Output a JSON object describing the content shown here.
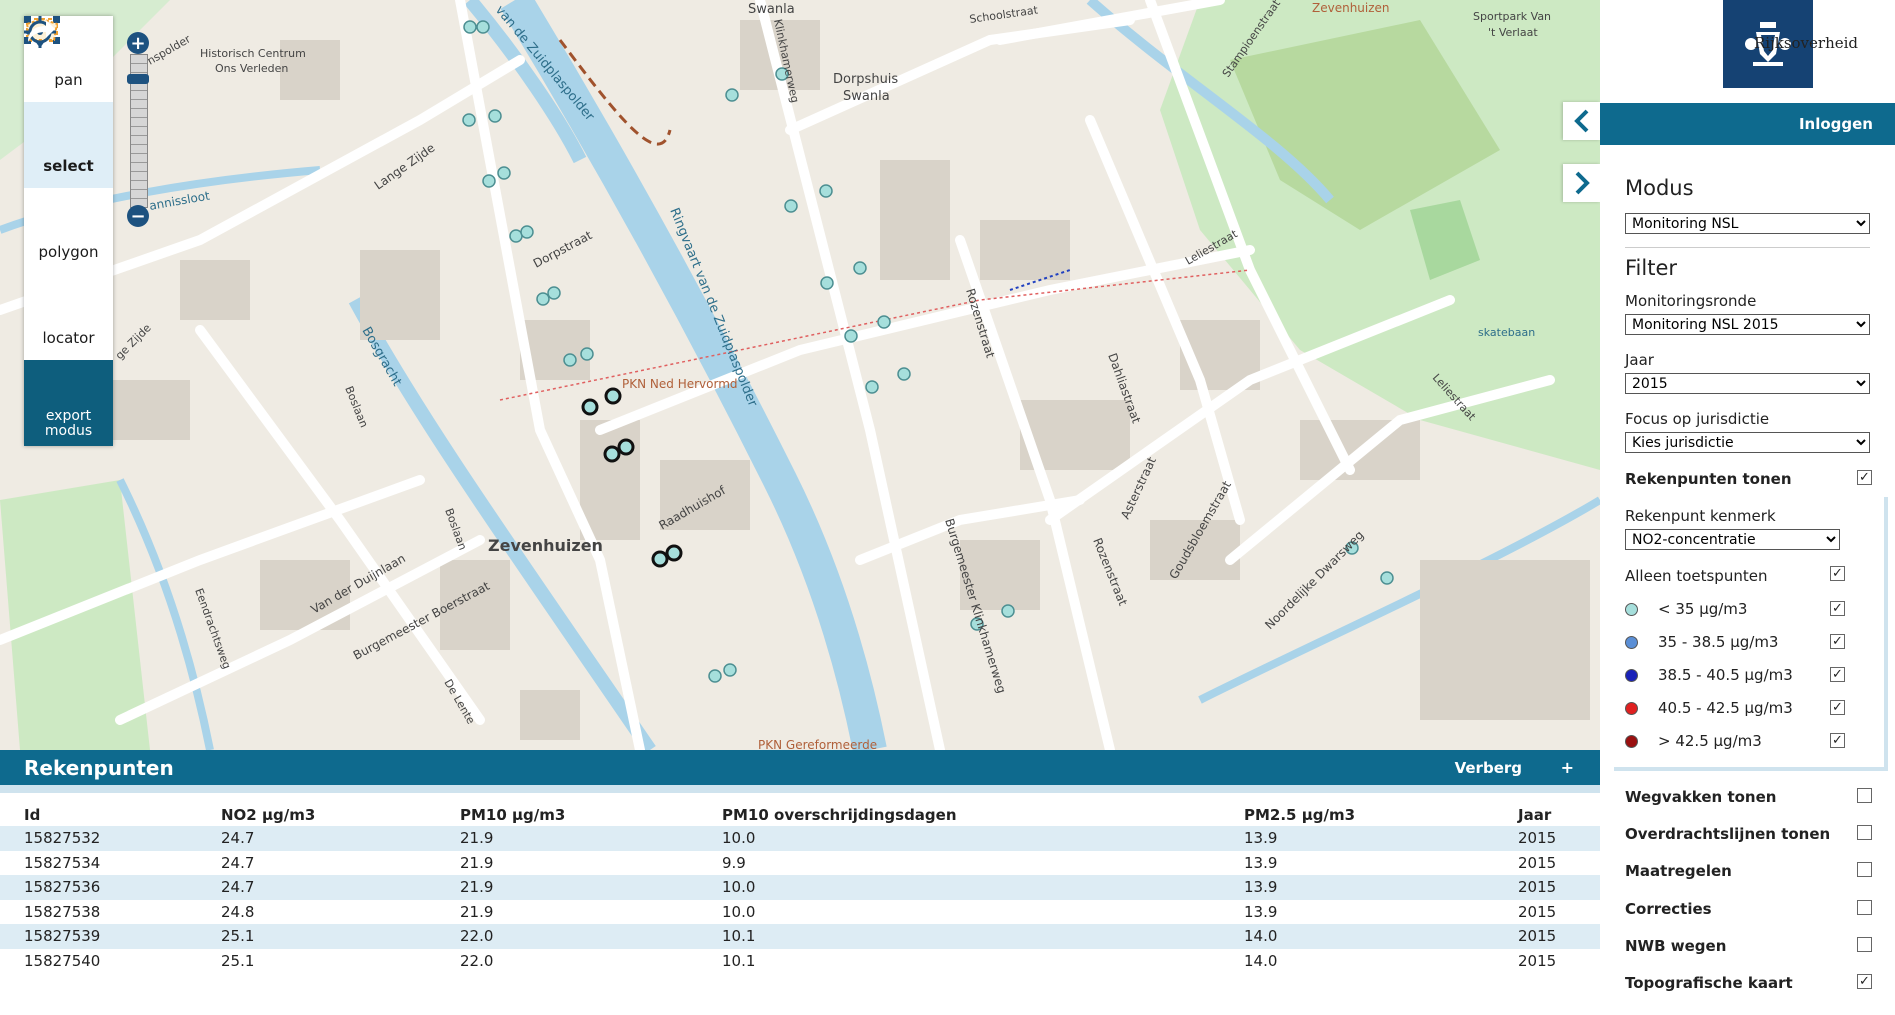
{
  "toolbar": {
    "pan": "pan",
    "select": "select",
    "polygon": "polygon",
    "locator": "locator",
    "export": "export modus"
  },
  "map": {
    "labels": {
      "town": "Zevenhuizen",
      "zevenhuizen_ne": "Zevenhuizen",
      "swanla": "Swanla",
      "dorpshuis": "Dorpshuis",
      "swanla2": "Swanla",
      "pkn_herv": "PKN Ned Hervormd",
      "pkn_geref": "PKN Gereformeerde",
      "historisch": "Historisch Centrum",
      "ons_verleden": "Ons Verleden",
      "sportpark": "Sportpark Van",
      "sportpark2": "'t Verlaat",
      "skatebaan": "skatebaan",
      "ringvaart": "Ringvaart van de Zuidplaspolder",
      "ringvaart2": "van de Zuidplaspolder",
      "bosgracht": "Bosgracht",
      "dorpstraat": "Dorpstraat",
      "lange_zijde": "Lange Zijde",
      "burgemeester_boerstraat": "Burgemeester Boerstraat",
      "van_der_duijnlaan": "Van der Duijnlaan",
      "kerkstraat": "Burgemeester Klinkhamerweg",
      "rozenstraat": "Rozenstraat",
      "rozenstraat2": "Rozenstraat",
      "dahliastraat": "Dahliastraat",
      "asterstraat": "Asterstraat",
      "goudsbloemstraat": "Goudsbloemstraat",
      "noordelijke_dwarsweg": "Noordelijke Dwarsweg",
      "schoolstraat": "Schoolstraat",
      "stampioenstraat": "Stampioenstraat",
      "leliestraat": "Leliestraat",
      "leliestraat2": "Leliestraat",
      "raadhuishof": "Raadhuishof",
      "klinkhamerweg": "Klinkhamerweg",
      "bosiaan": "Boslaan",
      "boslaan2": "Boslaan",
      "de_lente": "De Lente",
      "eendrachtsweg": "Eendrachtsweg",
      "annissloot": "annissloot",
      "nuge_zijde": "ge Zijde",
      "hansploder": "nspolder"
    }
  },
  "results": {
    "title": "Rekenpunten",
    "hide_label": "Verberg",
    "plus_label": "+",
    "columns": [
      "Id",
      "NO2 µg/m3",
      "PM10 µg/m3",
      "PM10 overschrijdingsdagen",
      "PM2.5 µg/m3",
      "Jaar"
    ],
    "rows": [
      [
        "15827532",
        "24.7",
        "21.9",
        "10.0",
        "13.9",
        "2015"
      ],
      [
        "15827534",
        "24.7",
        "21.9",
        "9.9",
        "13.9",
        "2015"
      ],
      [
        "15827536",
        "24.7",
        "21.9",
        "10.0",
        "13.9",
        "2015"
      ],
      [
        "15827538",
        "24.8",
        "21.9",
        "10.0",
        "13.9",
        "2015"
      ],
      [
        "15827539",
        "25.1",
        "22.0",
        "10.1",
        "14.0",
        "2015"
      ],
      [
        "15827540",
        "25.1",
        "22.0",
        "10.1",
        "14.0",
        "2015"
      ]
    ]
  },
  "sidebar": {
    "logo_text": "Rijksoverheid",
    "login": "Inloggen",
    "modus_heading": "Modus",
    "modus_value": "Monitoring NSL",
    "filter_heading": "Filter",
    "monitoringsronde_label": "Monitoringsronde",
    "monitoringsronde_value": "Monitoring NSL 2015",
    "jaar_label": "Jaar",
    "jaar_value": "2015",
    "focus_label": "Focus op jurisdictie",
    "focus_value": "Kies jurisdictie",
    "rekenpunten_tonen": "Rekenpunten tonen",
    "rekenpunt_kenmerk_label": "Rekenpunt kenmerk",
    "rekenpunt_kenmerk_value": "NO2-concentratie",
    "alleen_toetspunten": "Alleen toetspunten",
    "legend": [
      {
        "label": "< 35 µg/m3",
        "color": "#a6dfdc"
      },
      {
        "label": "35 - 38.5 µg/m3",
        "color": "#5b8fd6"
      },
      {
        "label": "38.5 - 40.5 µg/m3",
        "color": "#1a22b8"
      },
      {
        "label": "40.5 - 42.5 µg/m3",
        "color": "#e02020"
      },
      {
        "label": "> 42.5 µg/m3",
        "color": "#9a1010"
      }
    ],
    "layers": [
      {
        "label": "Wegvakken tonen",
        "checked": false
      },
      {
        "label": "Overdrachtslijnen tonen",
        "checked": false
      },
      {
        "label": "Maatregelen",
        "checked": false
      },
      {
        "label": "Correcties",
        "checked": false
      },
      {
        "label": "NWB wegen",
        "checked": false
      },
      {
        "label": "Topografische kaart",
        "checked": true
      }
    ]
  },
  "colors": {
    "accent": "#0e6a8e",
    "logo_bg": "#154273",
    "map_bg": "#efebe3",
    "water": "#a9d3e9",
    "green": "#bfe2b8"
  }
}
